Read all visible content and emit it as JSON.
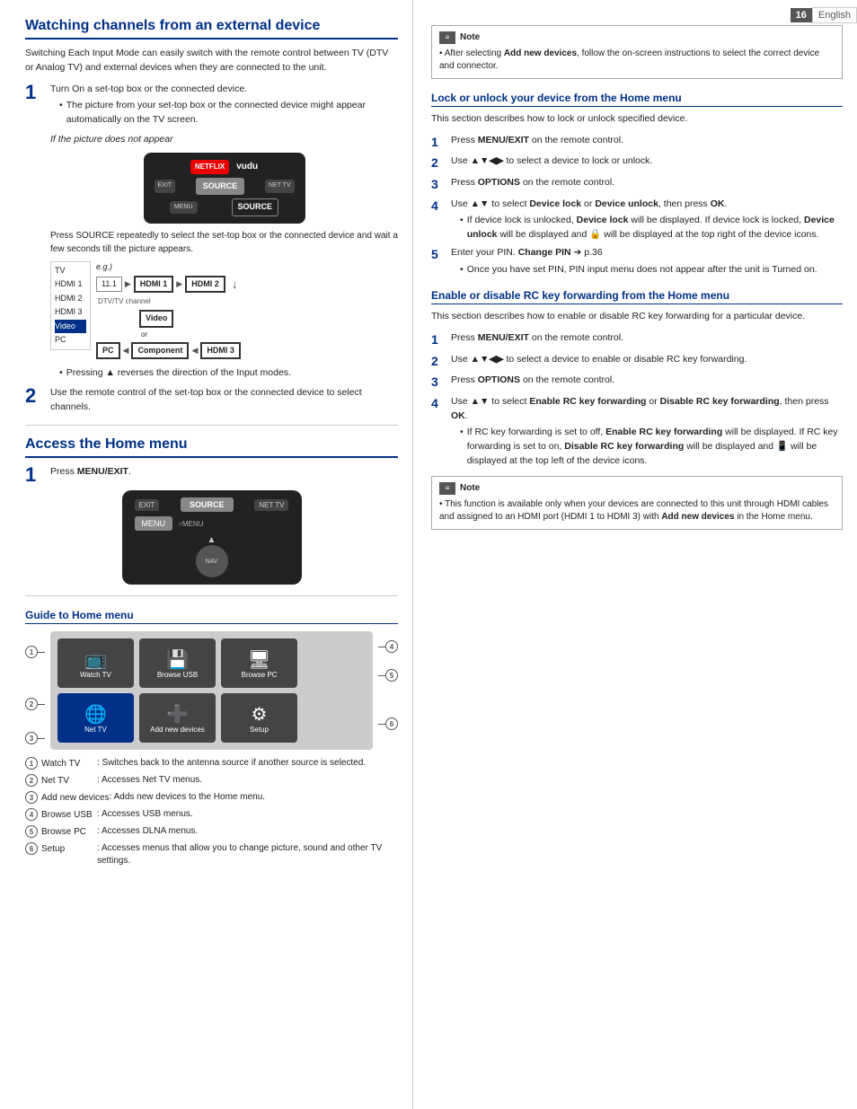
{
  "page": {
    "number": "16",
    "language": "English"
  },
  "left": {
    "section1": {
      "title": "Watching channels from an external device",
      "intro": "Switching Each Input Mode can easily switch with the remote control between TV (DTV or Analog TV) and external devices when they are connected to the unit.",
      "step1": {
        "num": "1",
        "text": "Turn On a set-top box or the connected device.",
        "bullet": "The picture from your set-top box or the connected device might appear automatically on the TV screen.",
        "italic_label": "If the picture does not appear",
        "source_note": "Press SOURCE repeatedly to select the set-top box or the connected device and wait a few seconds till the picture appears.",
        "bullet2": "Pressing ▲ reverses the direction of the Input modes."
      },
      "step2": {
        "num": "2",
        "text": "Use the remote control of the set-top box or the connected device to select channels."
      },
      "input_list": [
        "TV",
        "HDMI 1",
        "HDMI 2",
        "HDMI 3",
        "Video",
        "PC"
      ],
      "input_list_highlight": 4,
      "flow_label": "e.g.",
      "flow": [
        {
          "label": "11.1",
          "arrow": "▶",
          "next": "HDMI 1",
          "arrow2": "▶",
          "next2": "HDMI 2"
        },
        {
          "label": "DTV/TV channel",
          "indent": true
        },
        {
          "label2": "PC",
          "arrow": "◀",
          "prev": "Component",
          "arrow2": "◀",
          "prev2": "HDMI 3"
        }
      ]
    },
    "section2": {
      "title": "Access the Home menu",
      "step1": {
        "num": "1",
        "text": "Press MENU/EXIT."
      }
    },
    "guide": {
      "title": "Guide to Home menu",
      "items": [
        {
          "num": "1",
          "label": "Watch TV",
          "desc": ": Switches back to the antenna source if another source is selected."
        },
        {
          "num": "2",
          "label": "Net TV",
          "desc": ": Accesses Net TV menus."
        },
        {
          "num": "3",
          "label": "Add new devices",
          "desc": ": Adds new devices to the Home menu."
        },
        {
          "num": "4",
          "label": "Browse USB",
          "desc": ": Accesses USB menus."
        },
        {
          "num": "5",
          "label": "Browse PC",
          "desc": ": Accesses DLNA menus."
        },
        {
          "num": "6",
          "label": "Setup",
          "desc": ": Accesses menus that allow you to change picture, sound and other TV settings."
        }
      ],
      "menu_items_row1": [
        {
          "icon": "📺",
          "label": "Watch TV",
          "num": "1"
        },
        {
          "icon": "💾",
          "label": "Browse USB",
          "num": "4"
        },
        {
          "icon": "🖥",
          "label": "Browse PC",
          "num": "5"
        }
      ],
      "menu_items_row2": [
        {
          "icon": "🌐",
          "label": "Net TV",
          "num": "2"
        },
        {
          "icon": "➕",
          "label": "Add new devices",
          "num": "3"
        },
        {
          "icon": "⚙",
          "label": "Setup",
          "num": "6"
        }
      ]
    }
  },
  "right": {
    "note1": {
      "text": "After selecting Add new devices, follow the on-screen instructions to select the correct device and connector."
    },
    "section1": {
      "title": "Lock or unlock your device from the Home menu",
      "intro": "This section describes how to lock or unlock specified device.",
      "steps": [
        {
          "num": "1",
          "text": "Press MENU/EXIT on the remote control."
        },
        {
          "num": "2",
          "text": "Use ▲▼◀▶ to select a device to lock or unlock."
        },
        {
          "num": "3",
          "text": "Press OPTIONS on the remote control."
        },
        {
          "num": "4",
          "text": "Use ▲▼ to select Device lock or Device unlock, then press OK.",
          "bullets": [
            "If device lock is unlocked, Device lock will be displayed. If device lock is locked, Device unlock will be displayed and 🔒 will be displayed at the top right of the device icons."
          ]
        },
        {
          "num": "5",
          "text": "Enter your PIN. Change PIN ➔ p.36",
          "bullets": [
            "Once you have set PIN, PIN input menu does not appear after the unit is Turned on."
          ]
        }
      ]
    },
    "section2": {
      "title": "Enable or disable RC key forwarding from the Home menu",
      "intro": "This section describes how to enable or disable RC key forwarding for a particular device.",
      "steps": [
        {
          "num": "1",
          "text": "Press MENU/EXIT on the remote control."
        },
        {
          "num": "2",
          "text": "Use ▲▼◀▶ to select a device to enable or disable RC key forwarding."
        },
        {
          "num": "3",
          "text": "Press OPTIONS on the remote control."
        },
        {
          "num": "4",
          "text": "Use ▲▼ to select Enable RC key forwarding or Disable RC key forwarding, then press OK.",
          "bullets": [
            "If RC key forwarding is set to off, Enable RC key forwarding will be displayed. If RC key forwarding is set to on, Disable RC key forwarding will be displayed and 📱 will be displayed at the top left of the device icons."
          ]
        }
      ]
    },
    "note2": {
      "text": "This function is available only when your devices are connected to this unit through HDMI cables and assigned to an HDMI port (HDMI 1 to HDMI 3) with Add new devices in the Home menu."
    }
  }
}
